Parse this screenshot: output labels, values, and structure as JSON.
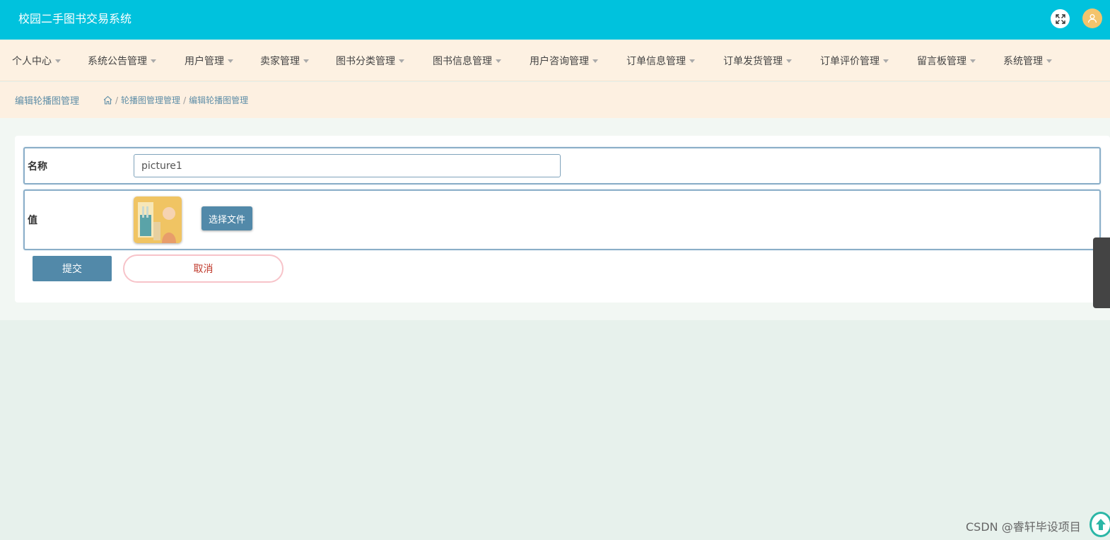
{
  "header": {
    "app_title": "校园二手图书交易系统",
    "icons": {
      "fullscreen": "fullscreen-icon",
      "avatar": "user-avatar-icon"
    },
    "colors": {
      "topbar": "#00c2dd",
      "avatar": "#f3c46d"
    }
  },
  "nav": {
    "items": [
      {
        "label": "个人中心"
      },
      {
        "label": "系统公告管理"
      },
      {
        "label": "用户管理"
      },
      {
        "label": "卖家管理"
      },
      {
        "label": "图书分类管理"
      },
      {
        "label": "图书信息管理"
      },
      {
        "label": "用户咨询管理"
      },
      {
        "label": "订单信息管理"
      },
      {
        "label": "订单发货管理"
      },
      {
        "label": "订单评价管理"
      },
      {
        "label": "留言板管理"
      },
      {
        "label": "系统管理"
      }
    ],
    "caret_icon": "caret-down-icon"
  },
  "breadcrumb": {
    "page_title": "编辑轮播图管理",
    "home_icon": "home-icon",
    "separator": "/",
    "items": [
      "轮播图管理管理",
      "编辑轮播图管理"
    ]
  },
  "form": {
    "name_label": "名称",
    "name_value": "picture1",
    "value_label": "值",
    "choose_file_label": "选择文件",
    "submit_label": "提交",
    "cancel_label": "取消"
  },
  "watermark": "CSDN @睿轩毕设项目",
  "colors": {
    "primary_button": "#5289a9",
    "cancel_text": "#c0392b",
    "scroll_top": "#2bb6a6"
  }
}
